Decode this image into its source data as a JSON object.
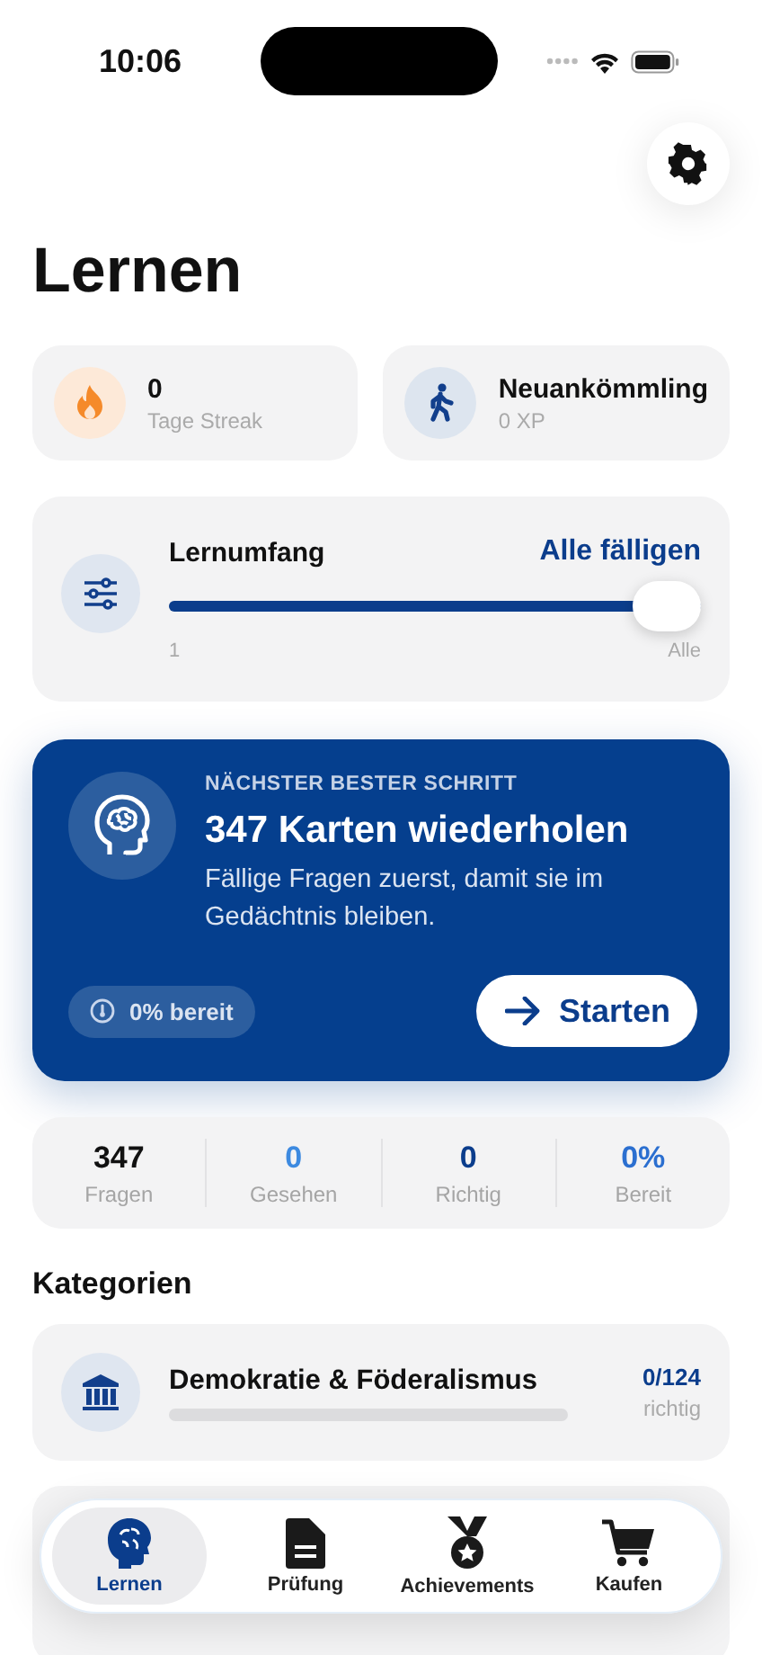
{
  "status_bar": {
    "time": "10:06"
  },
  "header": {
    "title": "Lernen"
  },
  "summary_cards": [
    {
      "kind": "streak",
      "value": "0",
      "label": "Tage Streak"
    },
    {
      "kind": "level",
      "value": "Neuankömmling",
      "label": "0 XP"
    }
  ],
  "scope": {
    "label": "Lernumfang",
    "value": "Alle fälligen",
    "level": 1,
    "min_label": "1",
    "max_label": "Alle"
  },
  "next_step": {
    "eyebrow": "NÄCHSTER BESTER SCHRITT",
    "title": "347 Karten wiederholen",
    "description": "Fällige Fragen zuerst, damit sie im Gedächtnis bleiben.",
    "readiness": "0% bereit",
    "button": "Starten"
  },
  "stats": [
    {
      "value": "347",
      "label": "Fragen",
      "color": "#111111"
    },
    {
      "value": "0",
      "label": "Gesehen",
      "color": "#3d8ae0"
    },
    {
      "value": "0",
      "label": "Richtig",
      "color": "#0b3d8c"
    },
    {
      "value": "0%",
      "label": "Bereit",
      "color": "#2b6fd0"
    }
  ],
  "categories": {
    "heading": "Kategorien",
    "items": [
      {
        "name": "Demokratie & Föderalismus",
        "level": 0,
        "count": "0/124",
        "count_label": "richtig"
      }
    ]
  },
  "tab_bar": [
    {
      "label": "Lernen",
      "selected": true
    },
    {
      "label": "Prüfung",
      "selected": false
    },
    {
      "label": "Achievements",
      "selected": false
    },
    {
      "label": "Kaufen",
      "selected": false
    }
  ]
}
